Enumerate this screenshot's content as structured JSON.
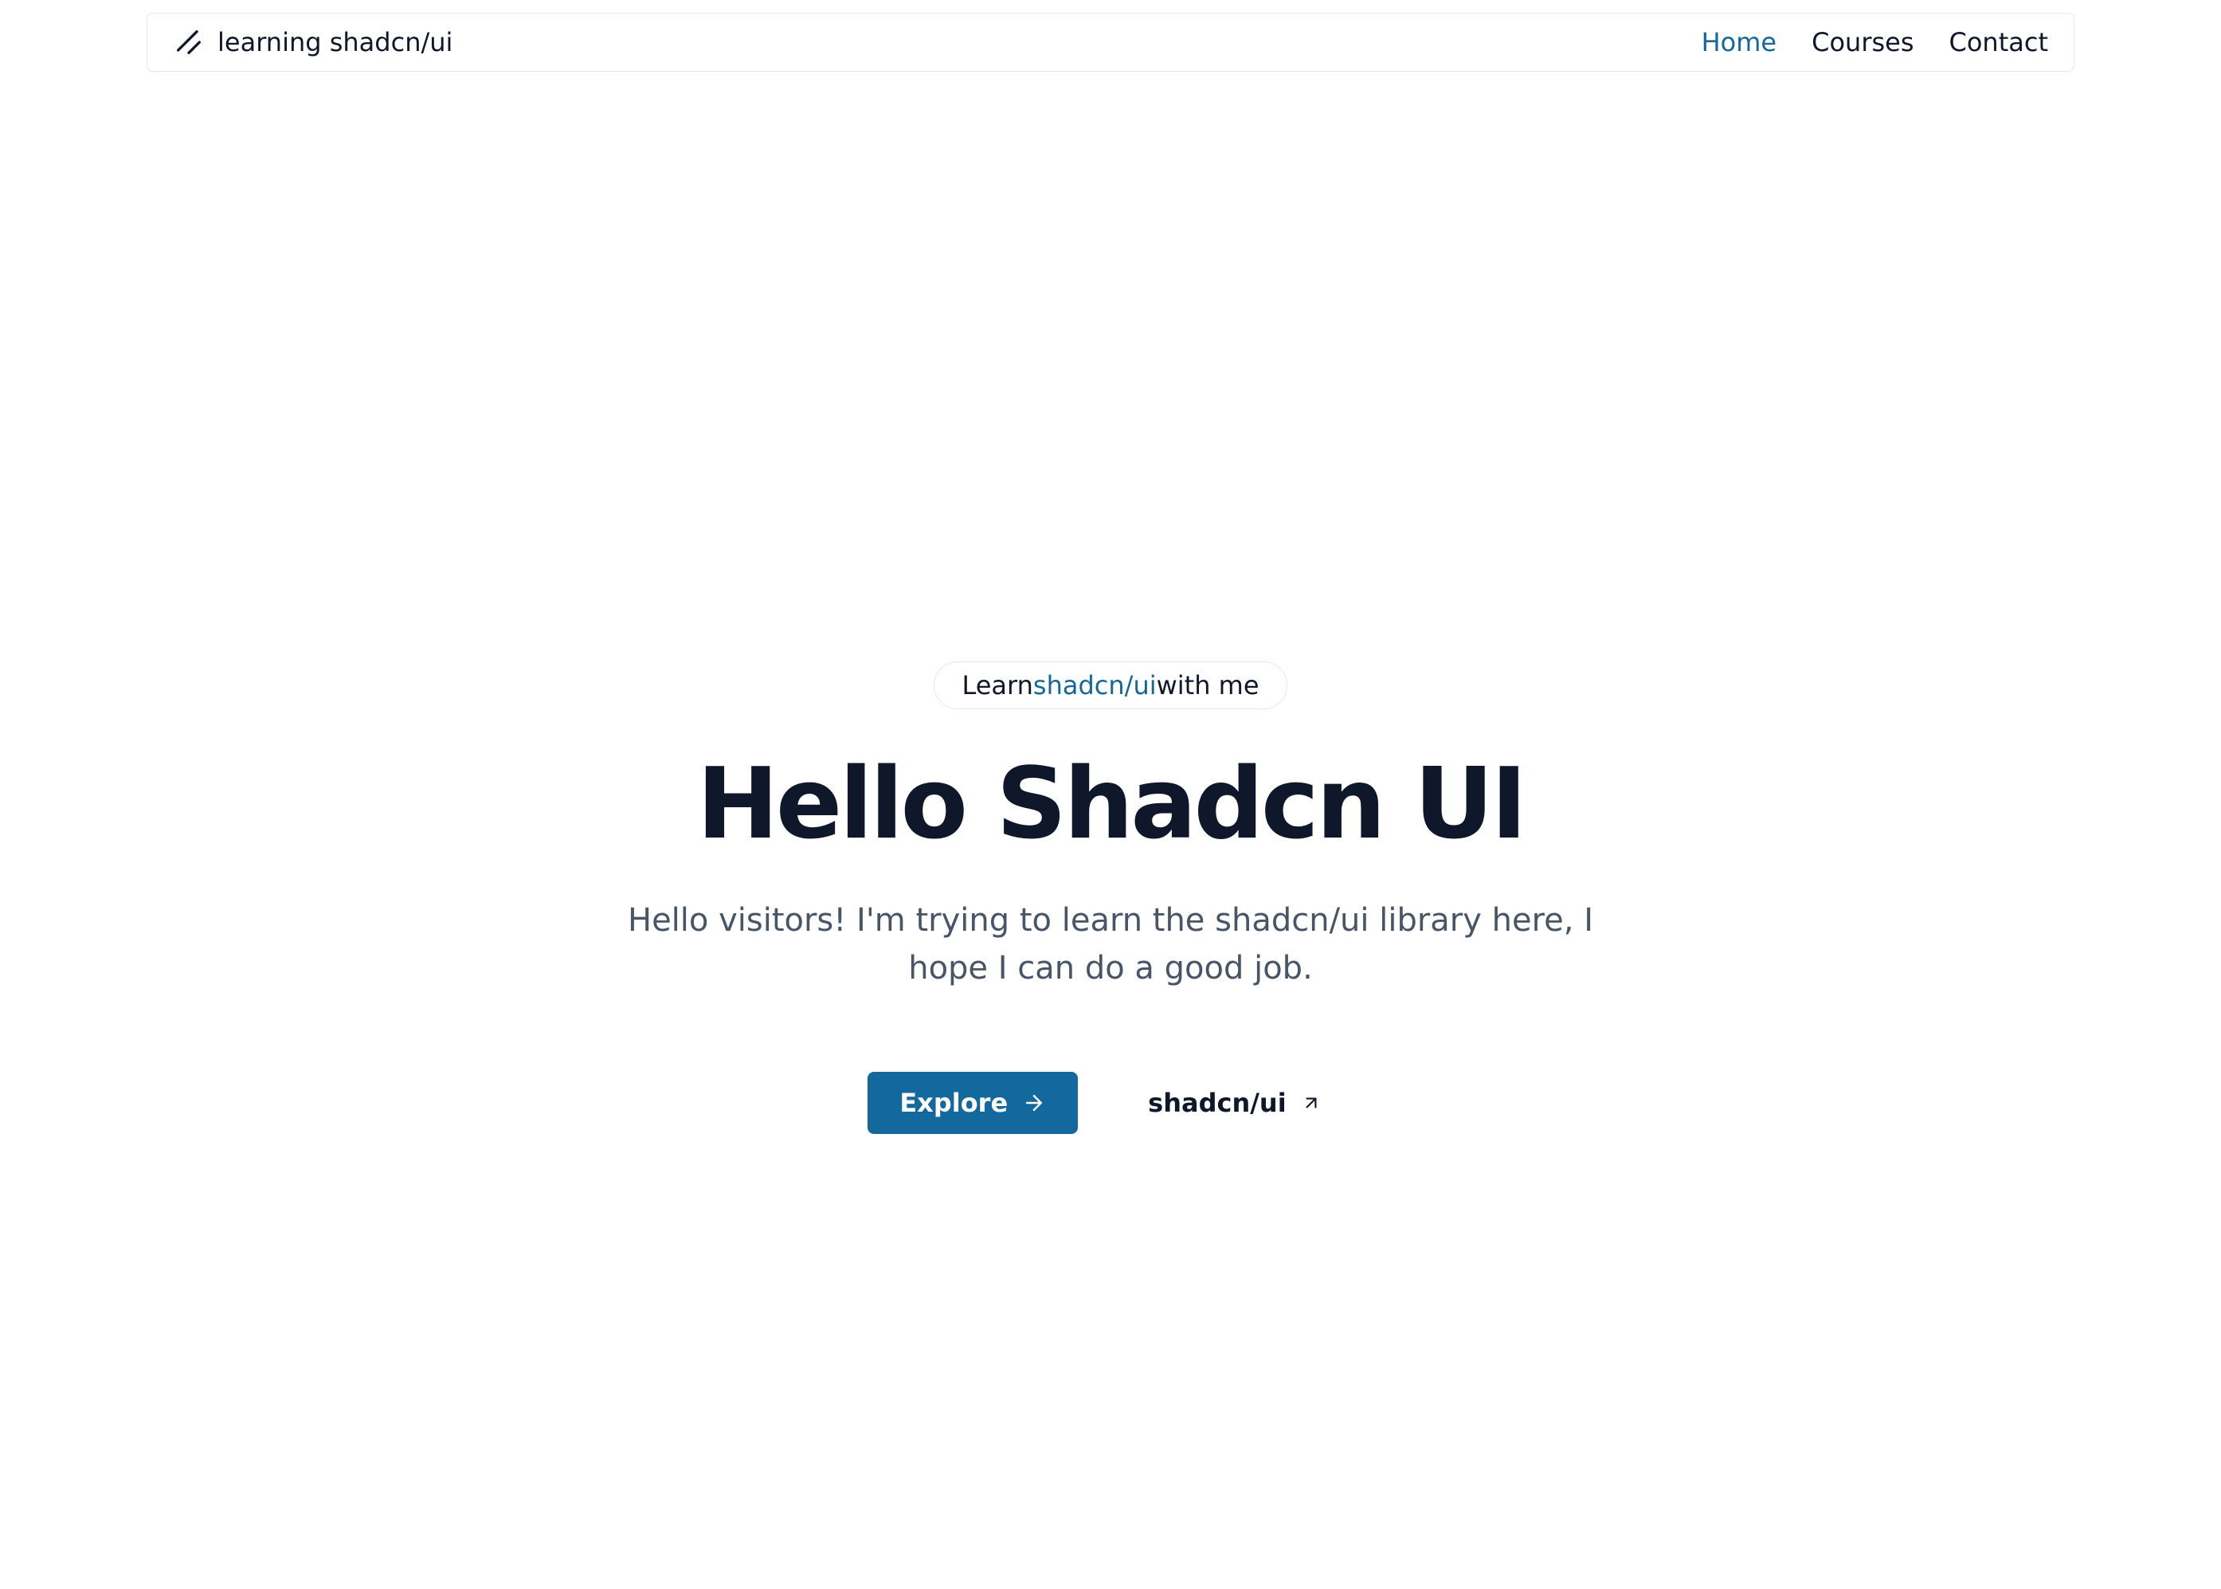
{
  "navbar": {
    "brand_text": "learning shadcn/ui",
    "links": [
      {
        "label": "Home",
        "active": true
      },
      {
        "label": "Courses",
        "active": false
      },
      {
        "label": "Contact",
        "active": false
      }
    ]
  },
  "hero": {
    "badge": {
      "prefix": "Learn ",
      "link": "shadcn/ui",
      "suffix": " with me"
    },
    "title": "Hello Shadcn UI",
    "description": "Hello visitors! I'm trying to learn the shadcn/ui library here, I hope I can do a good job.",
    "primary_cta": "Explore",
    "secondary_cta": "shadcn/ui"
  }
}
